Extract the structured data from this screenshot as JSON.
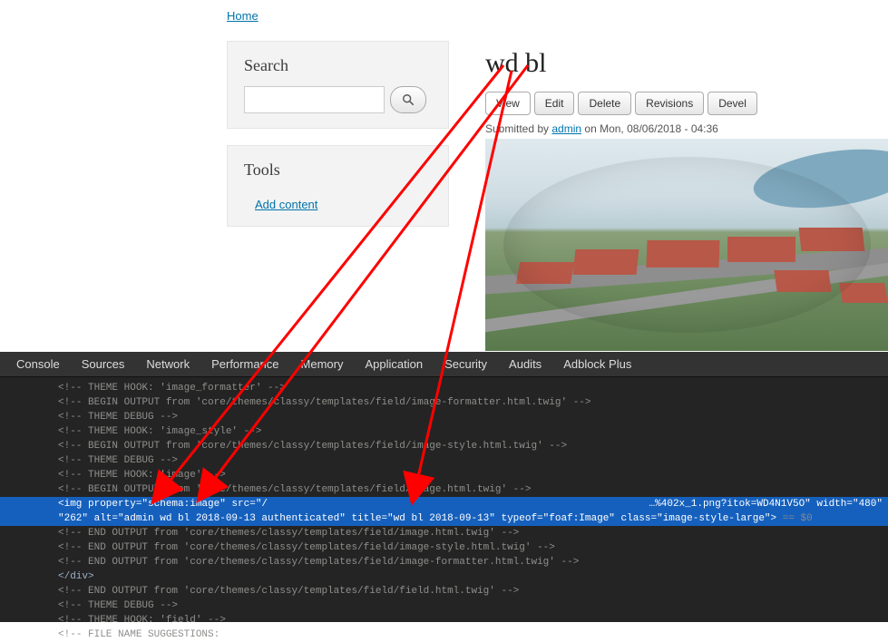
{
  "breadcrumb": {
    "home": "Home"
  },
  "sidebar": {
    "search": {
      "title": "Search",
      "value": ""
    },
    "tools": {
      "title": "Tools",
      "add_content": "Add content"
    }
  },
  "page": {
    "title": "wd bl"
  },
  "tabs": [
    {
      "label": "View",
      "active": true
    },
    {
      "label": "Edit",
      "active": false
    },
    {
      "label": "Delete",
      "active": false
    },
    {
      "label": "Revisions",
      "active": false
    },
    {
      "label": "Devel",
      "active": false
    }
  ],
  "submitted": {
    "prefix": "Submitted by ",
    "user": "admin",
    "suffix": " on Mon, 08/06/2018 - 04:36"
  },
  "devtools": {
    "tabs": [
      "Console",
      "Sources",
      "Network",
      "Performance",
      "Memory",
      "Application",
      "Security",
      "Audits",
      "Adblock Plus"
    ],
    "lines": [
      "<!-- THEME HOOK: 'image_formatter' -->",
      "<!-- BEGIN OUTPUT from 'core/themes/classy/templates/field/image-formatter.html.twig' -->",
      "<!-- THEME DEBUG -->",
      "<!-- THEME HOOK: 'image_style' -->",
      "<!-- BEGIN OUTPUT from 'core/themes/classy/templates/field/image-style.html.twig' -->",
      "<!-- THEME DEBUG -->",
      "<!-- THEME HOOK: 'image' -->",
      "<!-- BEGIN OUTPUT from 'core/themes/classy/templates/field/image.html.twig' -->"
    ],
    "img_line": {
      "open": "<img property=\"schema:image\" src=\"/",
      "url_tail": "…%402x_1.png?itok=WD4N1V5O\" width=\"480\"",
      "cont": "\"262\" alt=\"admin wd bl 2018-09-13 authenticated\" title=\"wd bl 2018-09-13\" typeof=\"foaf:Image\" class=\"image-style-large\">",
      "shadow": " == $0"
    },
    "after": [
      "<!-- END OUTPUT from 'core/themes/classy/templates/field/image.html.twig' -->",
      "<!-- END OUTPUT from 'core/themes/classy/templates/field/image-style.html.twig' -->",
      "<!-- END OUTPUT from 'core/themes/classy/templates/field/image-formatter.html.twig' -->"
    ],
    "closediv": "</div>",
    "after2": [
      "<!-- END OUTPUT from 'core/themes/classy/templates/field/field.html.twig' -->",
      "<!-- THEME DEBUG -->",
      "<!-- THEME HOOK: 'field' -->"
    ],
    "tail": "<!-- FILE NAME SUGGESTIONS:"
  }
}
